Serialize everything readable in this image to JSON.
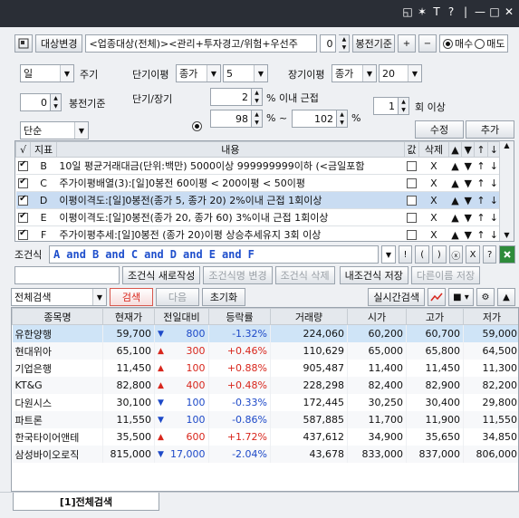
{
  "titlebar": {
    "icons": [
      "◱",
      "✶",
      "T",
      "?",
      "|",
      "—",
      "□",
      "✕"
    ]
  },
  "toolbar": {
    "target_button": "대상변경",
    "target_text": "<업종대상(전체)><관리+투자경고/위험+우선주",
    "target_num": "0",
    "bong_label": "봉전기준",
    "plus": "+",
    "minus": "−",
    "buy_label": "매수",
    "sell_label": "매도",
    "selected": "buy"
  },
  "params": {
    "period_value": "일",
    "period_label": "주기",
    "bong_value": "0",
    "bong_label": "봉전기준",
    "type_value": "단순",
    "short_ma_label": "단기이평",
    "short_price": "종가",
    "short_period": "5",
    "long_ma_label": "장기이평",
    "long_price": "종가",
    "long_period": "20",
    "short_long_label": "단기/장기",
    "cond1_value": "2",
    "cond1_suffix": "% 이내 근접",
    "cond2_low": "98",
    "cond2_mid": "% ~",
    "cond2_high": "102",
    "cond2_suffix": "%",
    "times_value": "1",
    "times_label": "회 이상",
    "edit_button": "수정",
    "add_button": "추가"
  },
  "indicators": {
    "headers": [
      "√",
      "지표",
      "내용",
      "값",
      "삭제",
      "▲",
      "▼",
      "↑",
      "↓"
    ],
    "rows": [
      {
        "checked": true,
        "key": "B",
        "content": "10일 평균거래대금(단위:백만) 5000이상 999999999이하 (<금일포함",
        "selected": false
      },
      {
        "checked": true,
        "key": "C",
        "content": "주가이평배열(3):[일]0봉전 60이평 < 200이평 < 50이평",
        "selected": false
      },
      {
        "checked": true,
        "key": "D",
        "content": "이평이격도:[일]0봉전(종가 5, 종가 20) 2%이내 근접 1회이상",
        "selected": true
      },
      {
        "checked": true,
        "key": "E",
        "content": "이평이격도:[일]0봉전(종가 20, 종가 60) 3%이내 근접 1회이상",
        "selected": false
      },
      {
        "checked": true,
        "key": "F",
        "content": "주가이평추세:[일]0봉전 (종가 20)이평 상승추세유지 3회 이상",
        "selected": false
      }
    ],
    "delete_symbol": "X",
    "move_symbols": [
      "▲",
      "▼",
      "↑",
      "↓"
    ]
  },
  "condition": {
    "label": "조건식",
    "tokens": [
      "A",
      "and",
      "B",
      "and",
      "C",
      "and",
      "D",
      "and",
      "E",
      "and",
      "F"
    ],
    "side_buttons": [
      "!",
      "(",
      ")",
      "ⓧ",
      "X",
      "?"
    ]
  },
  "actions": {
    "new_button": "조건식 새로작성",
    "rename_button": "조건식명 변경",
    "delete_button": "조건식 삭제",
    "save_button": "내조건식 저장",
    "save_as_button": "다른이름 저장"
  },
  "search": {
    "mode_value": "전체검색",
    "search_button": "검색",
    "next_button": "다음",
    "reset_button": "초기화",
    "realtime_button": "실시간검색"
  },
  "results": {
    "headers": [
      "종목명",
      "현재가",
      "전일대비",
      "등락률",
      "거래량",
      "시가",
      "고가",
      "저가"
    ],
    "rows": [
      {
        "name": "유한양행",
        "price": "59,700",
        "dir": "down",
        "change": "800",
        "rate": "-1.32%",
        "volume": "224,060",
        "open": "60,200",
        "high": "60,700",
        "low": "59,000"
      },
      {
        "name": "현대위아",
        "price": "65,100",
        "dir": "up",
        "change": "300",
        "rate": "+0.46%",
        "volume": "110,629",
        "open": "65,000",
        "high": "65,800",
        "low": "64,500"
      },
      {
        "name": "기업은행",
        "price": "11,450",
        "dir": "up",
        "change": "100",
        "rate": "+0.88%",
        "volume": "905,487",
        "open": "11,400",
        "high": "11,450",
        "low": "11,300"
      },
      {
        "name": "KT&G",
        "price": "82,800",
        "dir": "up",
        "change": "400",
        "rate": "+0.48%",
        "volume": "228,298",
        "open": "82,400",
        "high": "82,900",
        "low": "82,200"
      },
      {
        "name": "다원시스",
        "price": "30,100",
        "dir": "down",
        "change": "100",
        "rate": "-0.33%",
        "volume": "172,445",
        "open": "30,250",
        "high": "30,400",
        "low": "29,800"
      },
      {
        "name": "파트론",
        "price": "11,550",
        "dir": "down",
        "change": "100",
        "rate": "-0.86%",
        "volume": "587,885",
        "open": "11,700",
        "high": "11,900",
        "low": "11,550"
      },
      {
        "name": "한국타이어앤테",
        "price": "35,500",
        "dir": "up",
        "change": "600",
        "rate": "+1.72%",
        "volume": "437,612",
        "open": "34,900",
        "high": "35,650",
        "low": "34,850"
      },
      {
        "name": "삼성바이오로직",
        "price": "815,000",
        "dir": "down",
        "change": "17,000",
        "rate": "-2.04%",
        "volume": "43,678",
        "open": "833,000",
        "high": "837,000",
        "low": "806,000"
      }
    ]
  },
  "bottom_tab": {
    "label": "[1]전체검색"
  },
  "colors": {
    "up": "#d8261c",
    "down": "#1d49c8",
    "selected_row": "#cfe4f7",
    "accent_red": "#e03a2e"
  }
}
